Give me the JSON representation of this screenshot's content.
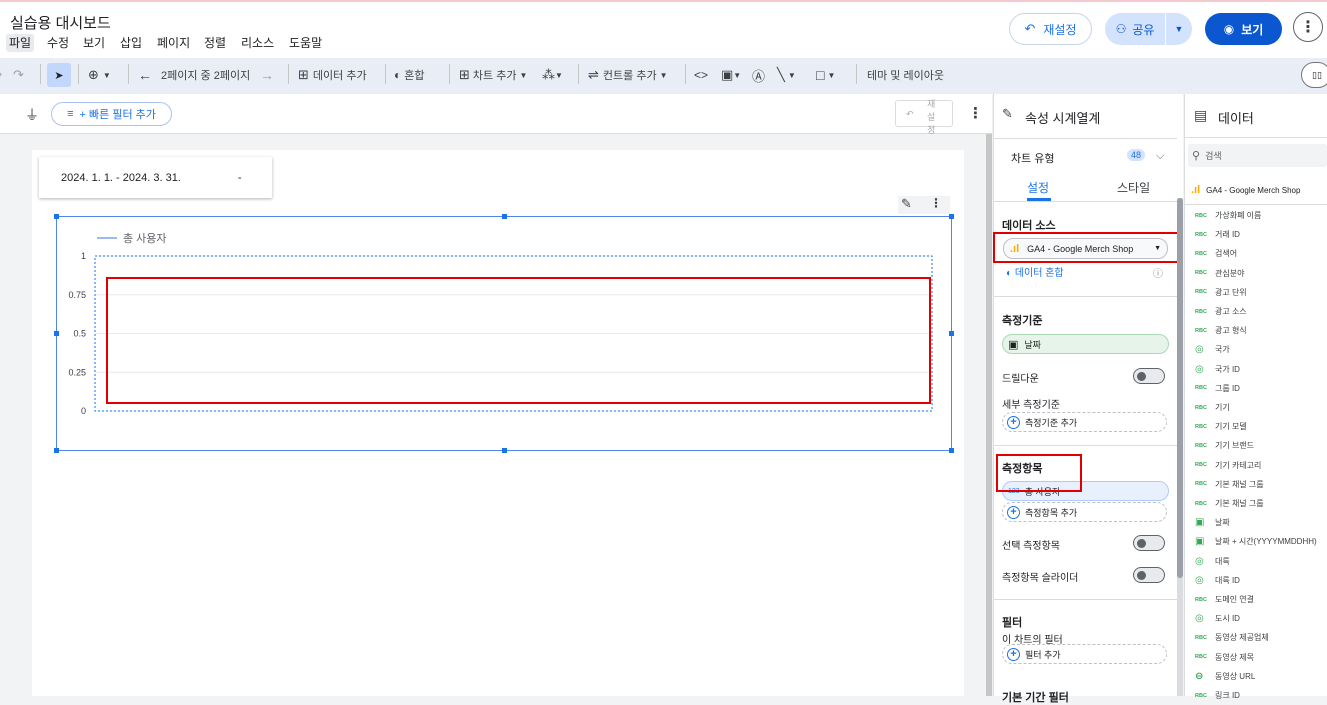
{
  "app": {
    "title": "실습용 대시보드",
    "menu": [
      "파일",
      "수정",
      "보기",
      "삽입",
      "페이지",
      "정렬",
      "리소스",
      "도움말"
    ]
  },
  "header": {
    "reset": "재설정",
    "share": "공유",
    "view": "보기"
  },
  "toolbar": {
    "page_nav": "2페이지 중 2페이지",
    "add_data": "데이터 추가",
    "blend": "혼합",
    "add_chart": "차트 추가",
    "add_control": "컨트롤 추가",
    "theme": "테마 및 레이아웃"
  },
  "filterbar": {
    "quick_filter": "+ 빠른 필터 추가",
    "mini_reset": [
      "재",
      "설",
      "정"
    ]
  },
  "date_control": {
    "range": "2024. 1. 1. - 2024. 3. 31.",
    "arrow": "-"
  },
  "chart_data": {
    "type": "line",
    "series": [
      {
        "name": "총 사용자",
        "values": []
      }
    ],
    "yticks": [
      "1",
      "0.75",
      "0.5",
      "0.25",
      "0"
    ],
    "ylim": [
      0,
      1
    ],
    "legend": "top-left",
    "grid": true
  },
  "props": {
    "title": "속성 시계열계",
    "chart_type_label": "차트 유형",
    "chart_count": "48",
    "tab_setup": "설정",
    "tab_style": "스타일",
    "data_source_head": "데이터 소스",
    "data_source": "GA4 - Google Merch Shop",
    "blend_data": "데이터 혼합",
    "dimension_head": "측정기준",
    "dimension_value": "날짜",
    "drilldown": "드릴다운",
    "breakdown_label": "세부 측정기준",
    "add_dimension": "측정기준 추가",
    "metric_head": "측정항목",
    "metric_value": "총 사용자",
    "add_metric": "측정항목 추가",
    "optional_metrics": "선택 측정항목",
    "metric_slider": "측정항목 슬라이더",
    "filter_head": "필터",
    "filter_sub": "이 차트의 필터",
    "add_filter": "필터 추가",
    "date_filter": "기본 기간 필터"
  },
  "data_panel": {
    "title": "데이터",
    "search": "검색",
    "source": "GA4 - Google Merch Shop",
    "fields": [
      {
        "type": "text",
        "icon": "RBC",
        "name": "가상화폐 이름"
      },
      {
        "type": "text",
        "icon": "RBC",
        "name": "거래 ID"
      },
      {
        "type": "text",
        "icon": "RBC",
        "name": "검색어"
      },
      {
        "type": "text",
        "icon": "RBC",
        "name": "관심분야"
      },
      {
        "type": "text",
        "icon": "RBC",
        "name": "광고 단위"
      },
      {
        "type": "text",
        "icon": "RBC",
        "name": "광고 소스"
      },
      {
        "type": "text",
        "icon": "RBC",
        "name": "광고 형식"
      },
      {
        "type": "geo",
        "icon": "◎",
        "name": "국가"
      },
      {
        "type": "geo",
        "icon": "◎",
        "name": "국가 ID"
      },
      {
        "type": "text",
        "icon": "RBC",
        "name": "그룹 ID"
      },
      {
        "type": "text",
        "icon": "RBC",
        "name": "기기"
      },
      {
        "type": "text",
        "icon": "RBC",
        "name": "기기 모델"
      },
      {
        "type": "text",
        "icon": "RBC",
        "name": "기기 브랜드"
      },
      {
        "type": "text",
        "icon": "RBC",
        "name": "기기 카테고리"
      },
      {
        "type": "text",
        "icon": "RBC",
        "name": "기본 채널 그룹"
      },
      {
        "type": "text",
        "icon": "RBC",
        "name": "기본 채널 그룹"
      },
      {
        "type": "date",
        "icon": "▣",
        "name": "날짜"
      },
      {
        "type": "date",
        "icon": "▣",
        "name": "날짜 + 시간(YYYYMMDDHH)"
      },
      {
        "type": "geo",
        "icon": "◎",
        "name": "대륙"
      },
      {
        "type": "geo",
        "icon": "◎",
        "name": "대륙 ID"
      },
      {
        "type": "text",
        "icon": "RBC",
        "name": "도메인 연결"
      },
      {
        "type": "geo",
        "icon": "◎",
        "name": "도시 ID"
      },
      {
        "type": "text",
        "icon": "RBC",
        "name": "동영상 제공업체"
      },
      {
        "type": "text",
        "icon": "RBC",
        "name": "동영상 제목"
      },
      {
        "type": "link",
        "icon": "⊖",
        "name": "동영상 URL"
      },
      {
        "type": "text",
        "icon": "RBC",
        "name": "링크 ID"
      }
    ]
  },
  "colors": {
    "accent": "#1a73e8",
    "highlight": "#e00000",
    "ga_orange": "#f9ab00"
  }
}
